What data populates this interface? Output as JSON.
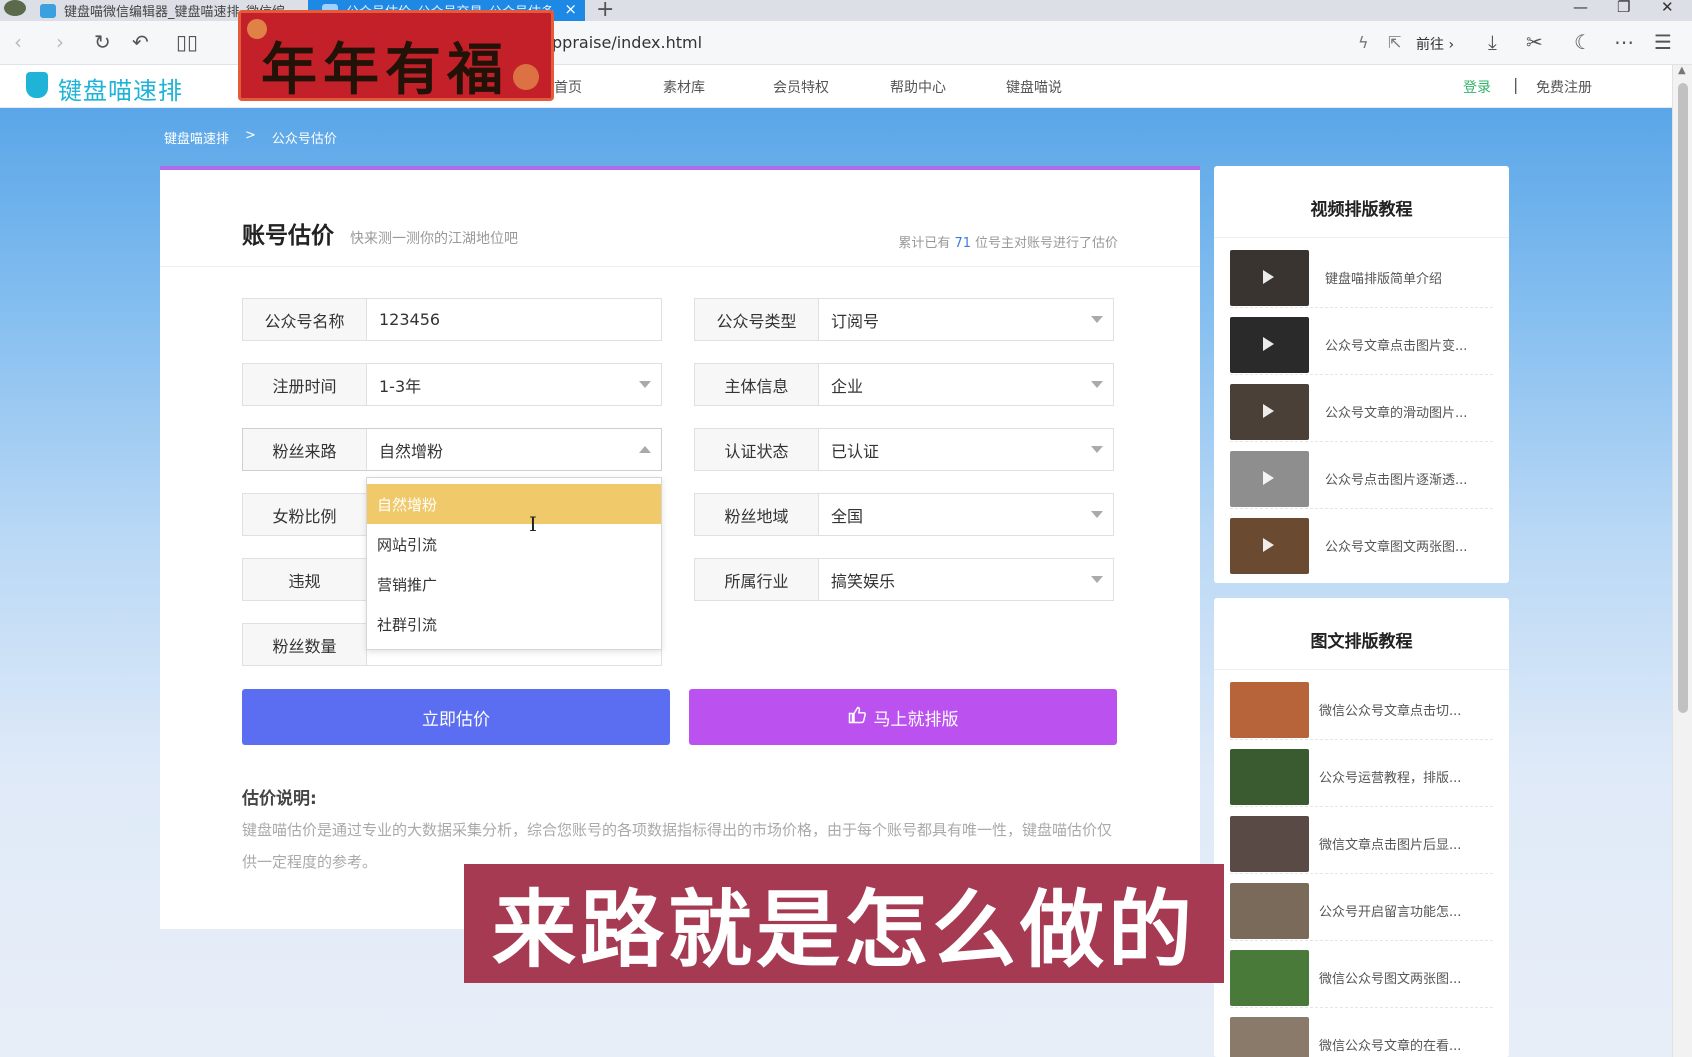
{
  "browser": {
    "tabs": [
      {
        "label": "键盘喵微信编辑器_键盘喵速排_微信编"
      },
      {
        "label": "公众号估价_公众号交易_公众号估多",
        "close": "×"
      }
    ],
    "new_tab": "+",
    "url": "ppraise/index.html",
    "go_label": "前往 ›",
    "window_controls": [
      "—",
      "❐",
      "✕"
    ]
  },
  "banner": {
    "text": "年年有福"
  },
  "site": {
    "logo_text": "键盘喵速排",
    "nav": [
      "首页",
      "素材库",
      "会员特权",
      "帮助中心",
      "键盘喵说"
    ],
    "login": "登录",
    "separator": "|",
    "register": "免费注册"
  },
  "breadcrumb": {
    "home": "键盘喵速排",
    "sep": ">",
    "current": "公众号估价"
  },
  "card": {
    "title": "账号估价",
    "subtitle": "快来测一测你的江湖地位吧",
    "stat_prefix": "累计已有",
    "stat_count": "71",
    "stat_suffix": "位号主对账号进行了估价"
  },
  "form": {
    "account_name": {
      "label": "公众号名称",
      "value": "123456"
    },
    "account_type": {
      "label": "公众号类型",
      "value": "订阅号"
    },
    "reg_time": {
      "label": "注册时间",
      "value": "1-3年"
    },
    "entity": {
      "label": "主体信息",
      "value": "企业"
    },
    "fan_source": {
      "label": "粉丝来路",
      "value": "自然增粉"
    },
    "verify": {
      "label": "认证状态",
      "value": "已认证"
    },
    "female_ratio": {
      "label": "女粉比例"
    },
    "fan_region": {
      "label": "粉丝地域",
      "value": "全国"
    },
    "violation": {
      "label": "违规"
    },
    "industry": {
      "label": "所属行业",
      "value": "搞笑娱乐"
    },
    "fan_count": {
      "label": "粉丝数量"
    }
  },
  "dropdown": {
    "options": [
      "自然增粉",
      "网站引流",
      "营销推广",
      "社群引流"
    ],
    "selected_index": 0
  },
  "buttons": {
    "estimate": "立即估价",
    "layout": "马上就排版",
    "layout_icon": "thumbs-up-icon"
  },
  "note": {
    "title": "估价说明:",
    "text": "键盘喵估价是通过专业的大数据采集分析，综合您账号的各项数据指标得出的市场价格，由于每个账号都具有唯一性，键盘喵估价仅供一定程度的参考。"
  },
  "sidebar": {
    "video": {
      "title": "视频排版教程",
      "items": [
        {
          "text": "键盘喵排版简单介绍",
          "color": "#3a3430"
        },
        {
          "text": "公众号文章点击图片变...",
          "color": "#2a2a2a"
        },
        {
          "text": "公众号文章的滑动图片...",
          "color": "#4a4038"
        },
        {
          "text": "公众号点击图片逐渐透...",
          "color": "#8e8e8e"
        },
        {
          "text": "公众号文章图文两张图...",
          "color": "#6a4a30"
        }
      ]
    },
    "article": {
      "title": "图文排版教程",
      "items": [
        {
          "text": "微信公众号文章点击切...",
          "color": "#b8643a"
        },
        {
          "text": "公众号运营教程，排版...",
          "color": "#3a5a30"
        },
        {
          "text": "微信文章点击图片后显...",
          "color": "#5a4a46"
        },
        {
          "text": "公众号开启留言功能怎...",
          "color": "#7a6a5a"
        },
        {
          "text": "微信公众号图文两张图...",
          "color": "#4a7a3a"
        },
        {
          "text": "微信公众号文章的在看...",
          "color": "#8a7a6a"
        }
      ]
    }
  },
  "overlay": {
    "subtitle": "来路就是怎么做的"
  },
  "colors": {
    "primary_button": "#5b6ef2",
    "secondary_button": "#bb52f0",
    "logo": "#1fb3d8",
    "dropdown_selected": "#f0c96a",
    "subtitle_bg": "#a53a52"
  }
}
